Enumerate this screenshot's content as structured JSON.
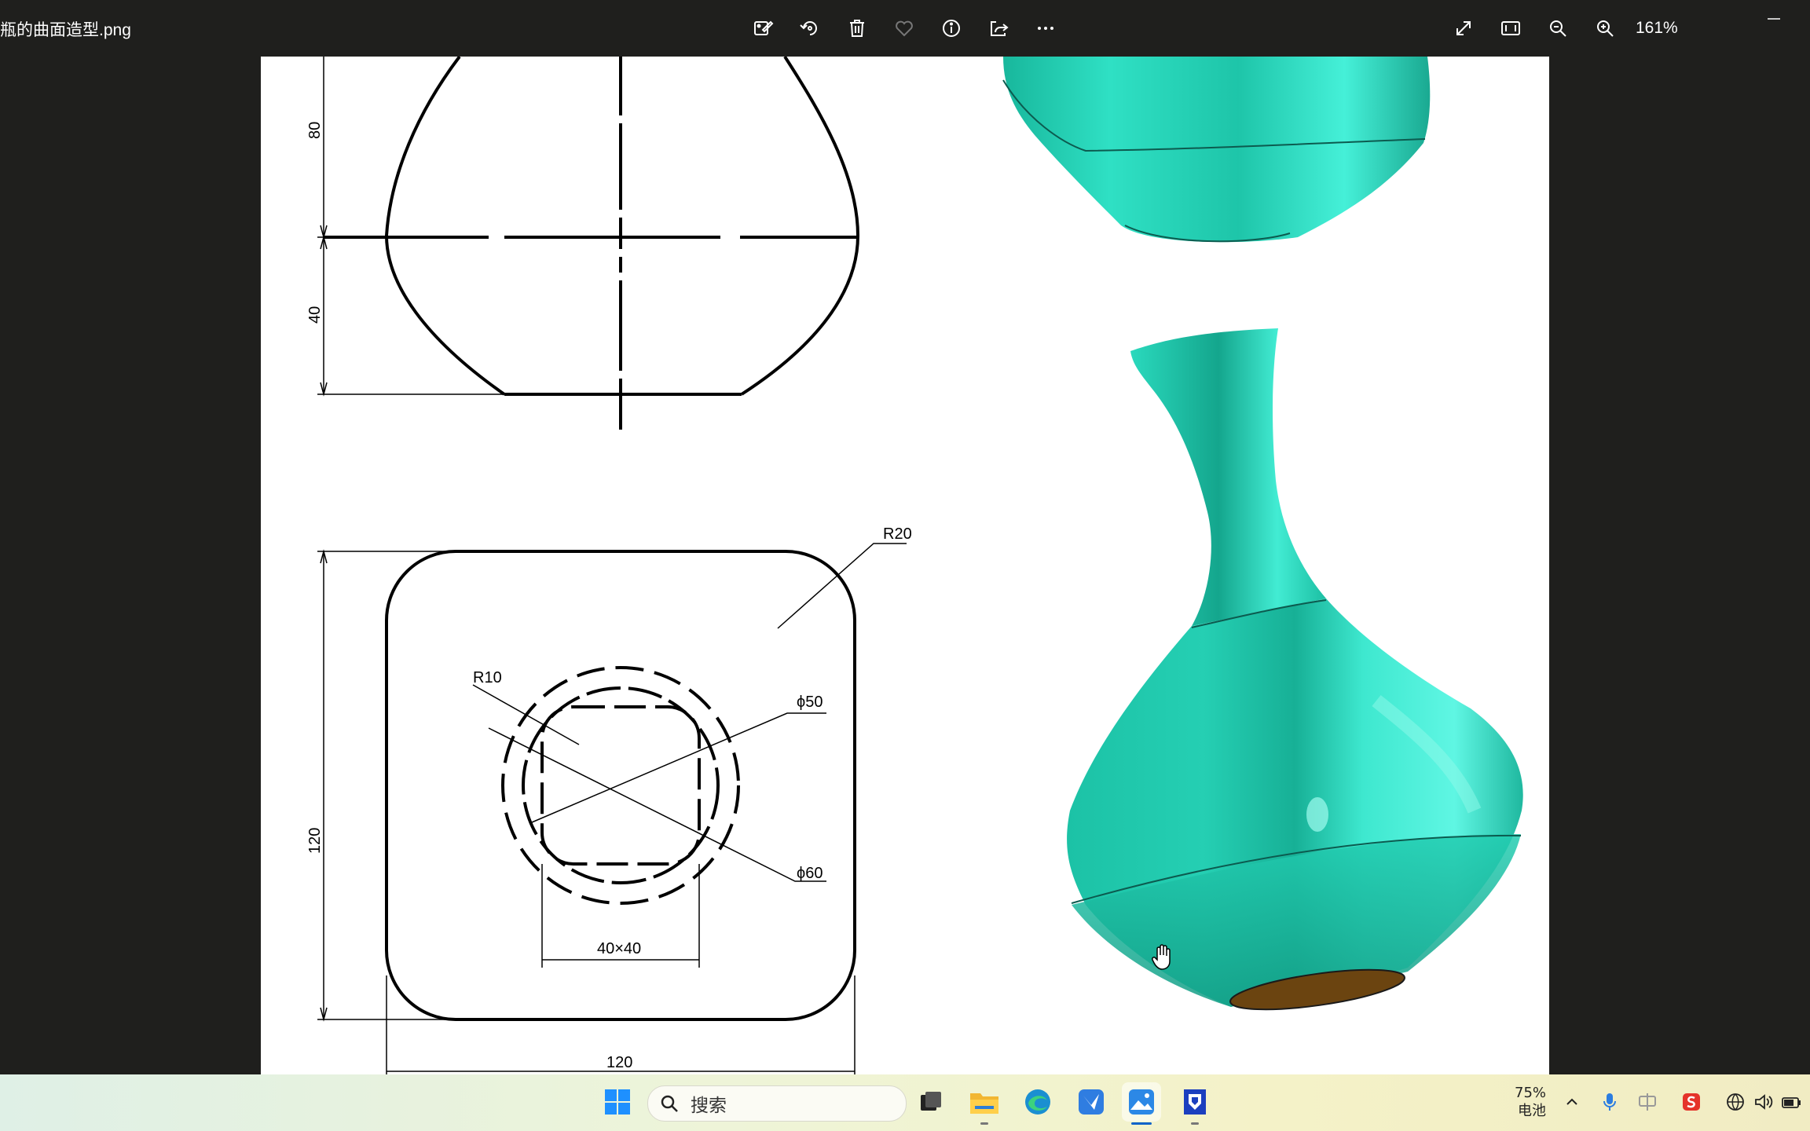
{
  "window": {
    "file_name": "瓶的曲面造型.png",
    "zoom": "161%"
  },
  "toolbar": {
    "center_icons": [
      "edit-icon",
      "rotate-icon",
      "delete-icon",
      "favorite-icon",
      "info-icon",
      "share-icon",
      "more-icon"
    ],
    "right_icons": [
      "fullscreen-icon",
      "fit-window-icon",
      "zoom-out-icon",
      "zoom-in-icon"
    ]
  },
  "drawing": {
    "dim_80": "80",
    "dim_40": "40",
    "dim_120_vertical": "120",
    "dim_120_horizontal": "120",
    "label_r20": "R20",
    "label_r10": "R10",
    "label_phi50": "ϕ50",
    "label_phi60": "ϕ60",
    "label_40x40": "40×40"
  },
  "colors": {
    "model_teal": "#23d3b6",
    "model_shadow": "#139a85",
    "model_highlight": "#7af7e6",
    "base_brown": "#6b4410",
    "topbar": "#1f1f1d"
  },
  "taskbar": {
    "search_placeholder": "搜索",
    "battery_percent": "75%",
    "battery_label": "电池",
    "apps": [
      "start-icon",
      "task-view-icon",
      "file-explorer-icon",
      "edge-icon",
      "feishu-icon",
      "photos-icon",
      "cad-app-icon"
    ]
  }
}
